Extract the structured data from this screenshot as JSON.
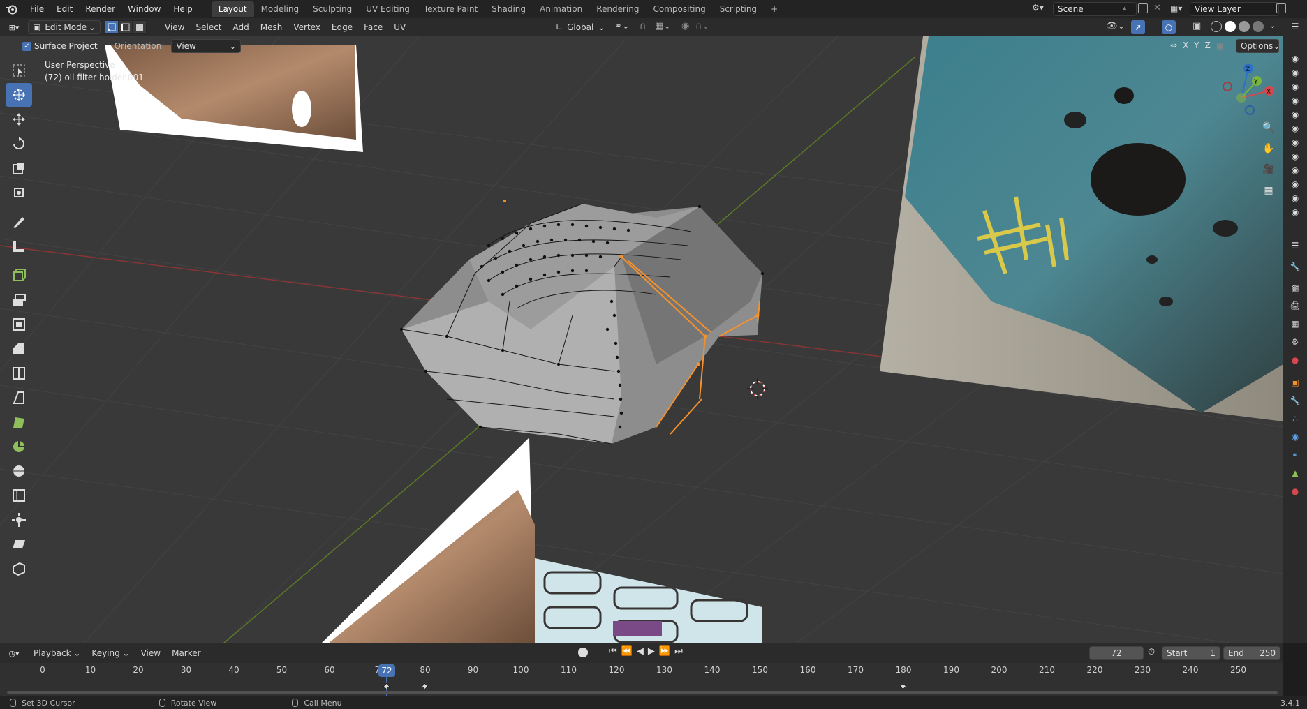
{
  "topbar": {
    "menus": [
      "File",
      "Edit",
      "Render",
      "Window",
      "Help"
    ],
    "workspaces": [
      "Layout",
      "Modeling",
      "Sculpting",
      "UV Editing",
      "Texture Paint",
      "Shading",
      "Animation",
      "Rendering",
      "Compositing",
      "Scripting"
    ],
    "active_workspace": "Layout",
    "add_tab": "+",
    "scene": "Scene",
    "view_layer": "View Layer"
  },
  "header": {
    "mode": "Edit Mode",
    "menus": [
      "View",
      "Select",
      "Add",
      "Mesh",
      "Vertex",
      "Edge",
      "Face",
      "UV"
    ],
    "transform_orientation": "Global",
    "options": "Options",
    "axes": [
      "X",
      "Y",
      "Z"
    ]
  },
  "tool_settings": {
    "surface_project_label": "Surface Project",
    "surface_project_checked": true,
    "orientation_label": "Orientation:",
    "orientation_value": "View"
  },
  "viewport": {
    "perspective": "User Perspective",
    "object_info": "(72) oil filter holder.001"
  },
  "gizmo": {
    "x": "X",
    "y": "Y",
    "z": "Z"
  },
  "toolbar_icons": [
    "select-box-icon",
    "cursor-icon",
    "move-icon",
    "rotate-icon",
    "scale-icon",
    "transform-icon",
    "annotate-icon",
    "measure-icon",
    "add-cube-icon",
    "extrude-icon",
    "inset-icon",
    "bevel-icon",
    "loop-cut-icon",
    "knife-icon",
    "poly-build-icon",
    "spin-icon",
    "smooth-icon",
    "edge-slide-icon",
    "shrink-fatten-icon",
    "shear-icon",
    "rip-icon"
  ],
  "timeline": {
    "menus": [
      "Playback",
      "Keying",
      "View",
      "Marker"
    ],
    "current_frame": "72",
    "start_label": "Start",
    "start": "1",
    "end_label": "End",
    "end": "250",
    "ticks": [
      "0",
      "10",
      "20",
      "30",
      "40",
      "50",
      "60",
      "7",
      "80",
      "90",
      "100",
      "110",
      "120",
      "130",
      "140",
      "150",
      "160",
      "170",
      "180",
      "190",
      "200",
      "210",
      "220",
      "230",
      "240",
      "250"
    ],
    "playhead_label": "72",
    "keyframes": [
      72,
      80,
      180
    ]
  },
  "status": {
    "left_click": "Set 3D Cursor",
    "middle_click": "Rotate View",
    "right_click": "Call Menu",
    "version": "3.4.1"
  },
  "colors": {
    "accent": "#4772b3",
    "selected_edge": "#f5922d",
    "x_axis": "#9b3a3a",
    "y_axis": "#6b8e23"
  }
}
